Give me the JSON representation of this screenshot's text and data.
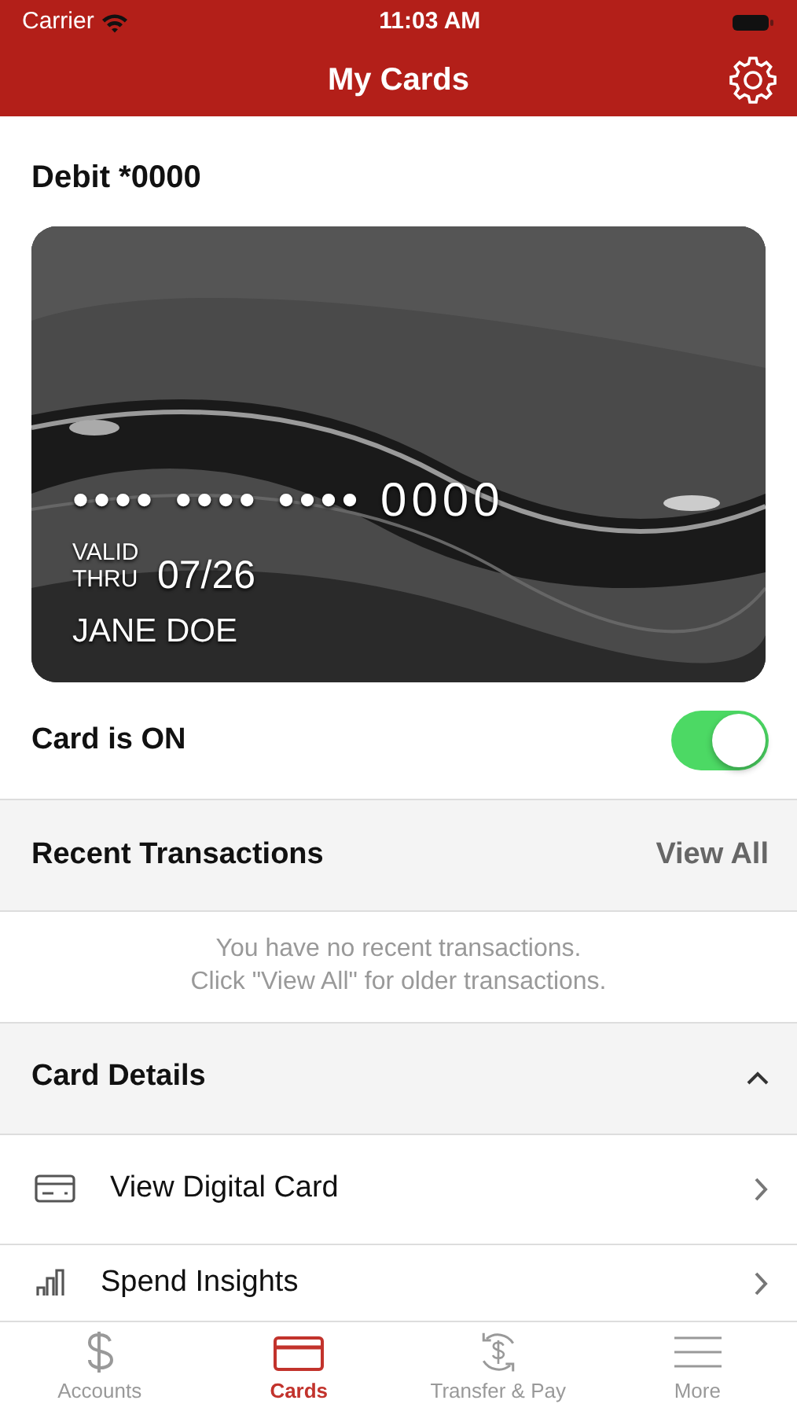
{
  "status_bar": {
    "carrier": "Carrier",
    "time": "11:03 AM"
  },
  "nav": {
    "title": "My Cards"
  },
  "card": {
    "title": "Debit *0000",
    "number_mask": "•••• •••• •••• ",
    "last4": "0000",
    "valid_label": "VALID THRU",
    "expiry": "07/26",
    "holder": "JANE DOE"
  },
  "card_toggle": {
    "label": "Card is ON",
    "on": true
  },
  "recent": {
    "title": "Recent Transactions",
    "link": "View All",
    "empty_lines": [
      "You have no recent transactions.",
      "Click \"View All\" for older transactions."
    ]
  },
  "details": {
    "title": "Card Details",
    "expanded": true,
    "items": [
      {
        "kind": "card",
        "label": "View Digital Card"
      },
      {
        "kind": "chart",
        "label": "Spend Insights"
      }
    ]
  },
  "tabs": [
    {
      "kind": "dollar",
      "label": "Accounts",
      "selected": false
    },
    {
      "kind": "card",
      "label": "Cards",
      "selected": true
    },
    {
      "kind": "transfer",
      "label": "Transfer & Pay",
      "selected": false
    },
    {
      "kind": "menu",
      "label": "More",
      "selected": false
    }
  ]
}
